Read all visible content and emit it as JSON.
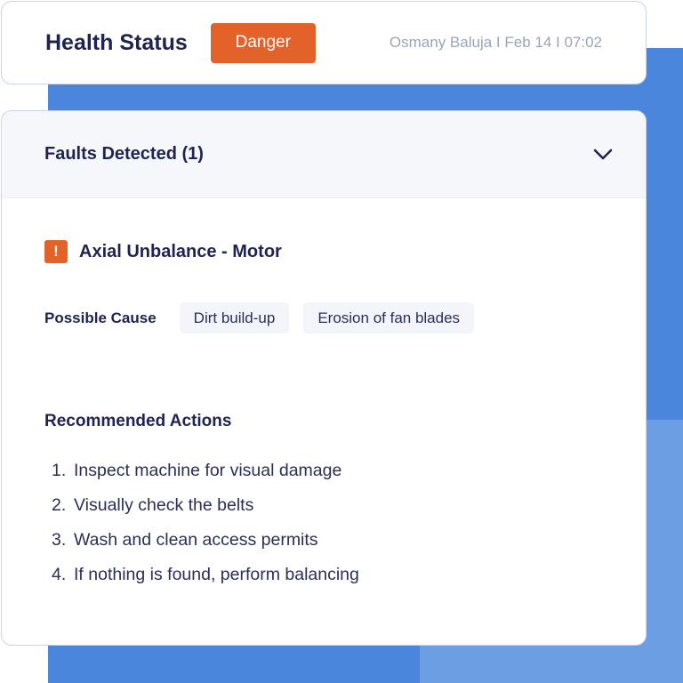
{
  "header": {
    "title": "Health Status",
    "status": "Danger",
    "meta": "Osmany Baluja I Feb 14 I 07:02"
  },
  "faults": {
    "title": "Faults Detected (1)",
    "fault_name": "Axial Unbalance - Motor",
    "possible_cause_label": "Possible Cause",
    "causes": [
      "Dirt build-up",
      "Erosion of fan blades"
    ]
  },
  "actions": {
    "title": "Recommended Actions",
    "items": [
      {
        "num": "1.",
        "text": "Inspect machine for visual damage"
      },
      {
        "num": "2.",
        "text": "Visually check the belts"
      },
      {
        "num": "3.",
        "text": "Wash and clean access permits"
      },
      {
        "num": "4.",
        "text": "If nothing is found, perform balancing"
      }
    ]
  },
  "colors": {
    "danger": "#e2622a",
    "navy": "#1f2350",
    "background_blue": "#4a86dc",
    "background_light_blue": "#6c9ee3"
  },
  "icons": {
    "collapse": "chevron-down-icon",
    "fault": "warning-icon"
  }
}
